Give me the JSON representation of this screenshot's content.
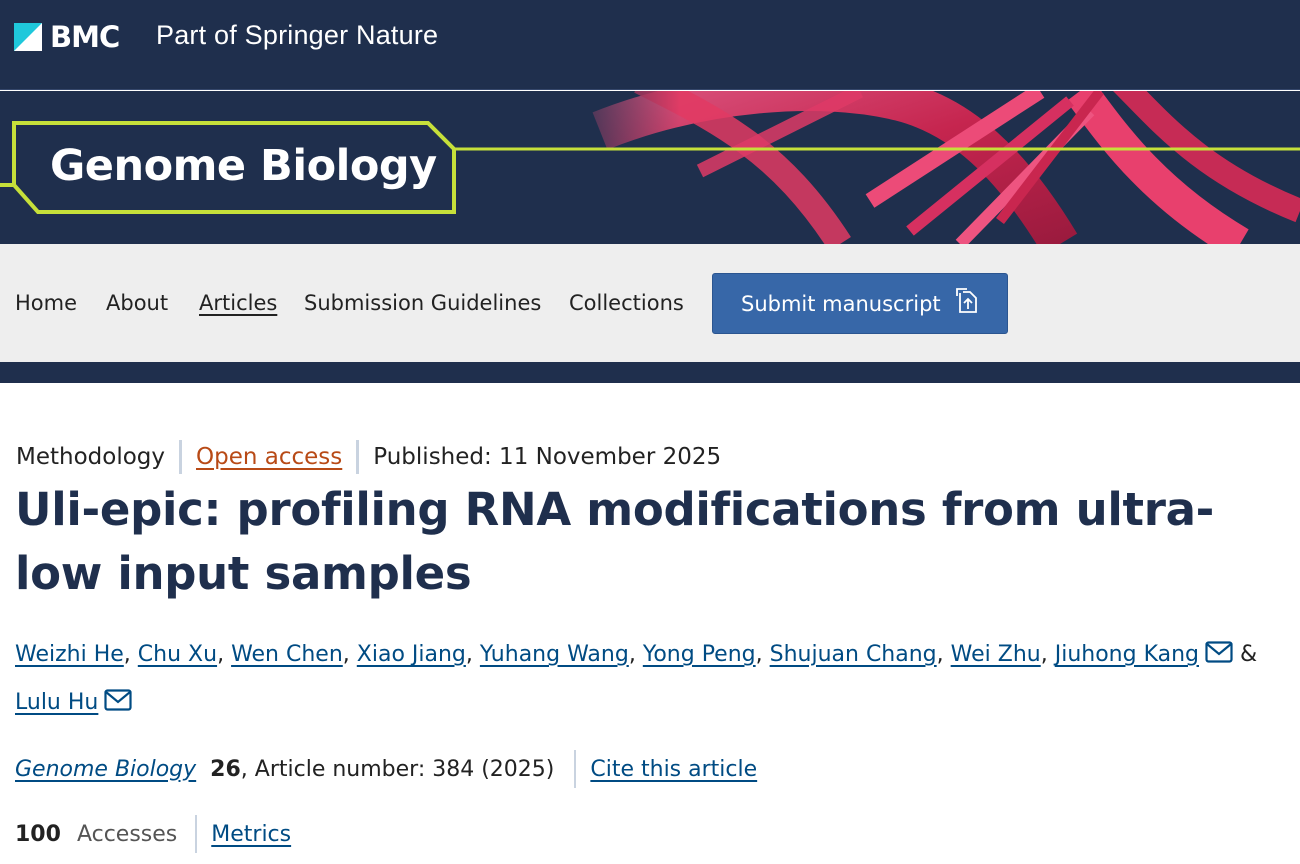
{
  "header": {
    "logo_text": "BMC",
    "tagline": "Part of Springer Nature"
  },
  "banner": {
    "journal_title": "Genome Biology"
  },
  "nav": {
    "items": [
      {
        "label": "Home"
      },
      {
        "label": "About"
      },
      {
        "label": "Articles"
      },
      {
        "label": "Submission Guidelines"
      },
      {
        "label": "Collections"
      }
    ],
    "active": "Articles",
    "submit_label": "Submit manuscript"
  },
  "article": {
    "type": "Methodology",
    "access": "Open access",
    "published": "Published: 11 November 2025",
    "title": "Uli-epic: profiling RNA modifications from ultra-low input samples",
    "authors": [
      {
        "name": "Weizhi He"
      },
      {
        "name": "Chu Xu"
      },
      {
        "name": "Wen Chen"
      },
      {
        "name": "Xiao Jiang"
      },
      {
        "name": "Yuhang Wang"
      },
      {
        "name": "Yong Peng"
      },
      {
        "name": "Shujuan Chang"
      },
      {
        "name": "Wei Zhu"
      },
      {
        "name": "Jiuhong Kang"
      },
      {
        "name": "Lulu Hu"
      }
    ],
    "authors_conjunction": "&",
    "citation": {
      "journal": "Genome Biology",
      "volume": "26",
      "rest": ", Article number: 384 (2025)",
      "cite_label": "Cite this article"
    },
    "metrics": {
      "accesses_count": "100",
      "accesses_label": "Accesses",
      "metrics_label": "Metrics"
    }
  },
  "colors": {
    "brand_navy": "#1f2f4d",
    "accent_lime": "#c6e03a",
    "button_blue": "#3767a8",
    "link_blue": "#004b83",
    "open_access_orange": "#b84a16"
  }
}
